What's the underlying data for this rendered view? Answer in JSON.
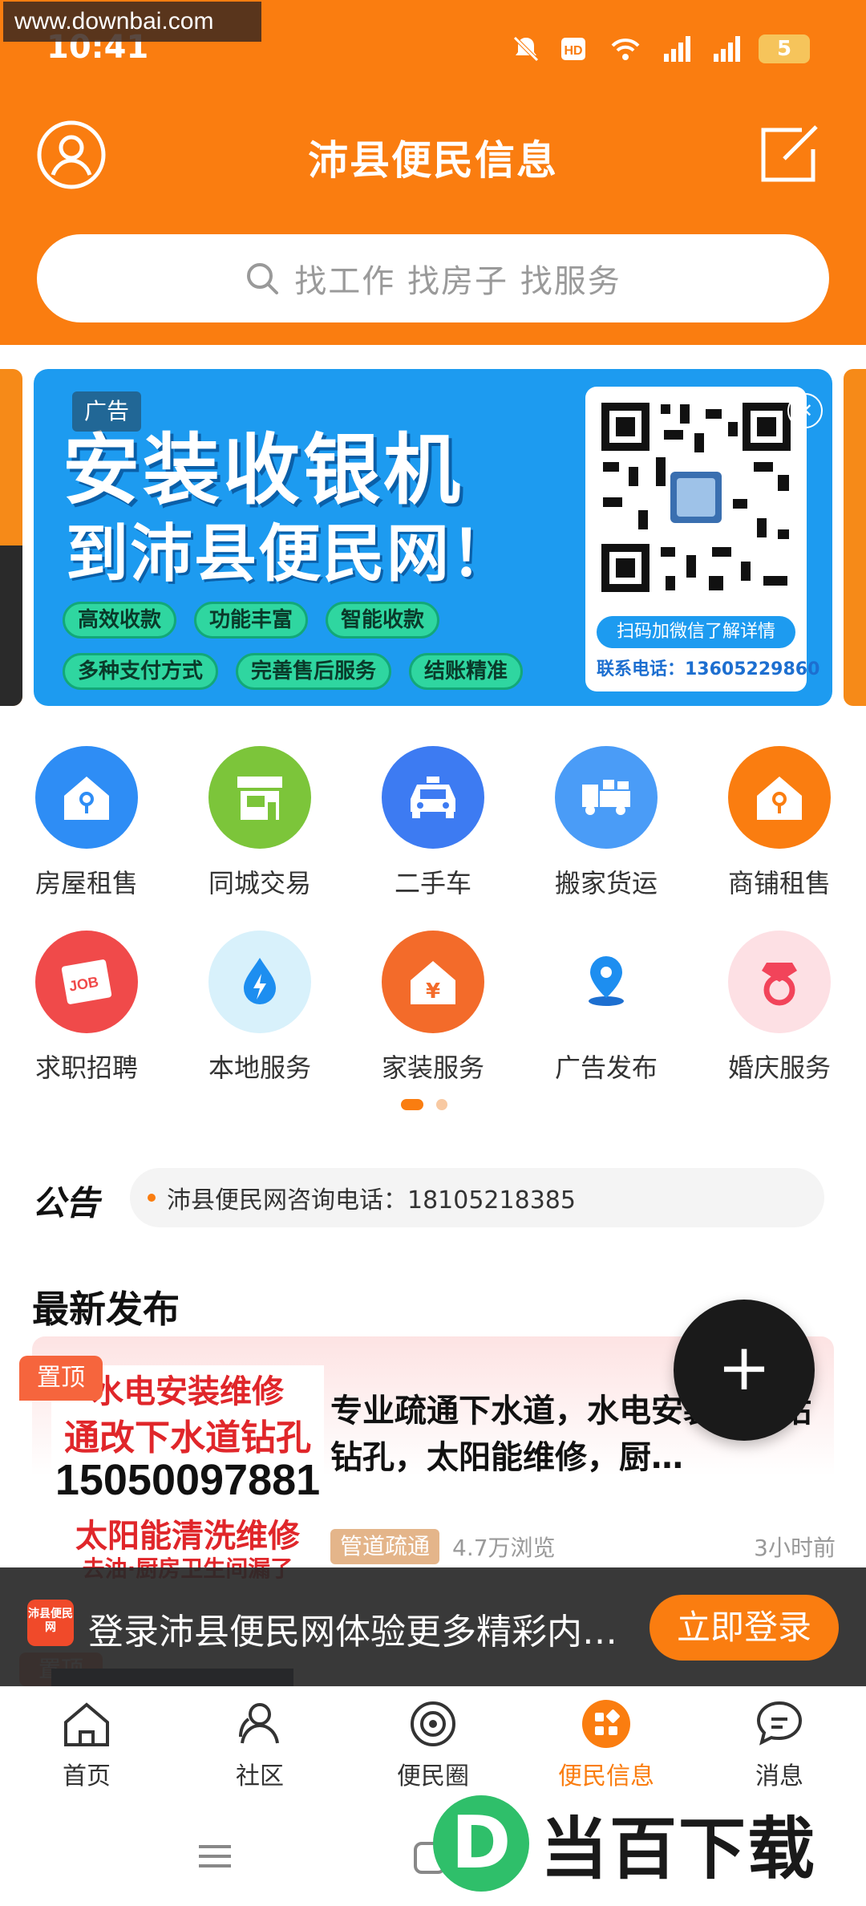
{
  "status_bar": {
    "time": "10:41",
    "watermark_url": "www.downbai.com",
    "battery": "5"
  },
  "header": {
    "title": "沛县便民信息",
    "avatar_icon": "user-avatar-icon",
    "post_icon": "edit-post-icon",
    "bg_color": "#fa7d10"
  },
  "search": {
    "placeholder": "找工作  找房子  找服务"
  },
  "banner": {
    "ad_tag": "广告",
    "headline": "安装收银机",
    "subline": "到沛县便民网！",
    "tags": [
      "高效收款",
      "功能丰富",
      "智能收款",
      "多种支付方式",
      "完善售后服务",
      "结账精准"
    ],
    "qr_caption": "扫码加微信了解详情",
    "contact": "联系电话：13605229860",
    "close": "✕"
  },
  "categories": [
    {
      "label": "房屋租售",
      "icon": "house-key-icon",
      "color": "#2e8df5"
    },
    {
      "label": "同城交易",
      "icon": "shop-icon",
      "color": "#7cc53a"
    },
    {
      "label": "二手车",
      "icon": "car-icon",
      "color": "#3d7bf2"
    },
    {
      "label": "搬家货运",
      "icon": "truck-icon",
      "color": "#4a9cf7"
    },
    {
      "label": "商铺租售",
      "icon": "store-key-icon",
      "color": "#fa7d10"
    },
    {
      "label": "求职招聘",
      "icon": "job-icon",
      "color": "#f04a4a"
    },
    {
      "label": "本地服务",
      "icon": "water-drop-icon",
      "color": "#d8f1fb"
    },
    {
      "label": "家装服务",
      "icon": "home-decor-icon",
      "color": "#f36b2a"
    },
    {
      "label": "广告发布",
      "icon": "location-pin-icon",
      "color": "#ffffff"
    },
    {
      "label": "婚庆服务",
      "icon": "ring-icon",
      "color": "#fde0e4"
    }
  ],
  "announcement": {
    "logo": "公告",
    "text": "沛县便民网咨询电话：18105218385"
  },
  "latest": {
    "title": "最新发布",
    "listing": {
      "pin": "置顶",
      "thumb_lines": [
        "水电安装维修",
        "通改下水道钻孔",
        "15050097881",
        "太阳能清洗维修",
        "去油·厨房卫生间漏了"
      ],
      "title": "专业疏通下水道，水电安装，水钻钻孔，太阳能维修，厨…",
      "tag": "管道疏通",
      "views": "4.7万浏览",
      "time": "3小时前"
    },
    "second_pin": "置顶"
  },
  "fab": {
    "label": "+"
  },
  "login_prompt": {
    "logo": "沛县便民网",
    "text": "登录沛县便民网体验更多精彩内…",
    "button": "立即登录"
  },
  "bottom_nav": [
    {
      "label": "首页",
      "icon": "home-icon",
      "active": false
    },
    {
      "label": "社区",
      "icon": "community-icon",
      "active": false
    },
    {
      "label": "便民圈",
      "icon": "circle-icon",
      "active": false
    },
    {
      "label": "便民信息",
      "icon": "grid-apps-icon",
      "active": true
    },
    {
      "label": "消息",
      "icon": "message-icon",
      "active": false
    }
  ],
  "brand_watermark": {
    "logo": "D",
    "text": "当百下载"
  }
}
